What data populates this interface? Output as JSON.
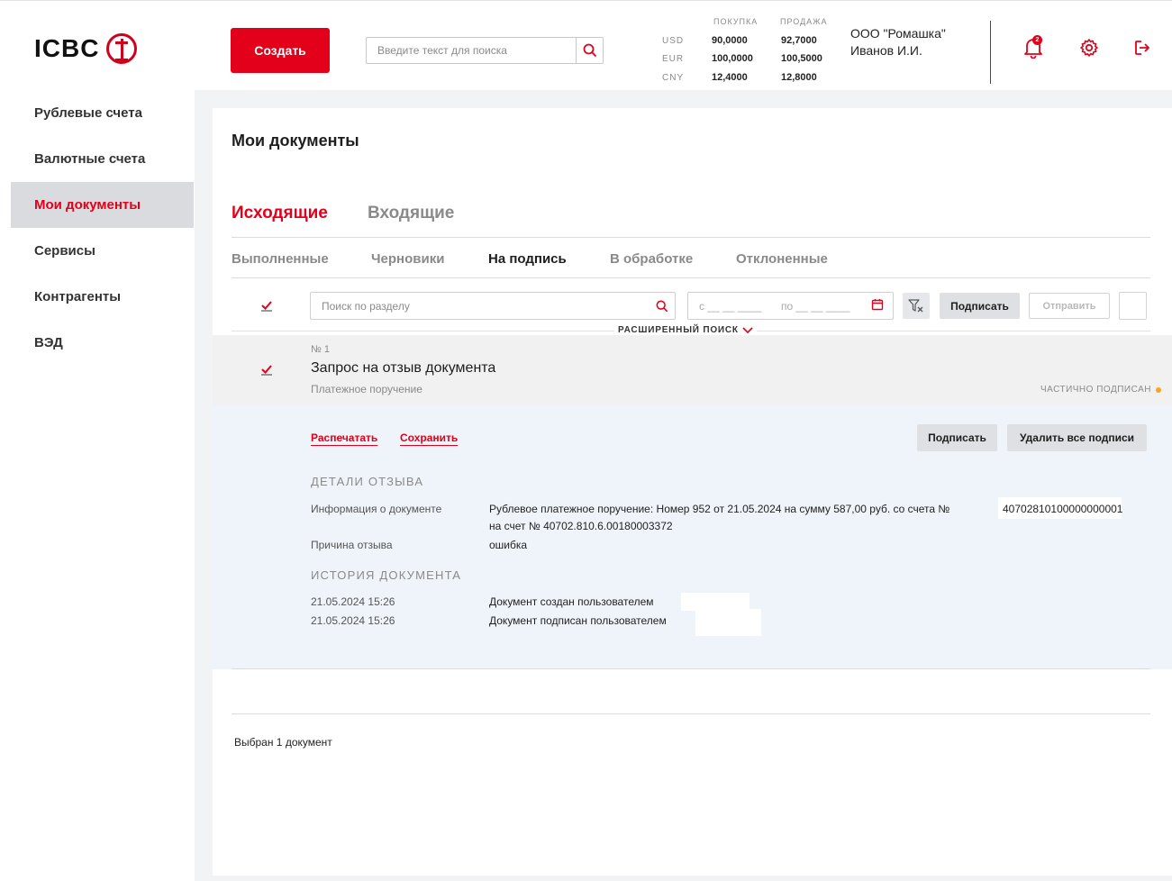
{
  "brand": {
    "logo_text": "ICBC",
    "accent_color": "#e2001a"
  },
  "header": {
    "create_label": "Создать",
    "search_placeholder": "Введите текст для поиска",
    "rates": {
      "buy_header": "ПОКУПКА",
      "sell_header": "ПРОДАЖА",
      "rows": [
        {
          "currency": "USD",
          "buy": "90,0000",
          "sell": "92,7000"
        },
        {
          "currency": "EUR",
          "buy": "100,0000",
          "sell": "100,5000"
        },
        {
          "currency": "CNY",
          "buy": "12,4000",
          "sell": "12,8000"
        }
      ]
    },
    "org_name": "ООО \"Ромашка\"",
    "user_name": "Иванов И.И.",
    "notifications_count": "2"
  },
  "sidebar": {
    "items": [
      {
        "label": "Рублевые счета"
      },
      {
        "label": "Валютные счета"
      },
      {
        "label": "Мои документы",
        "active": true
      },
      {
        "label": "Сервисы"
      },
      {
        "label": "Контрагенты"
      },
      {
        "label": "ВЭД"
      }
    ]
  },
  "main": {
    "title": "Мои документы",
    "tabs": [
      {
        "label": "Исходящие",
        "active": true
      },
      {
        "label": "Входящие"
      }
    ],
    "subtabs": [
      {
        "label": "Выполненные"
      },
      {
        "label": "Черновики"
      },
      {
        "label": "На подпись",
        "active": true
      },
      {
        "label": "В обработке"
      },
      {
        "label": "Отклоненные"
      }
    ],
    "toolbar": {
      "search_placeholder": "Поиск по разделу",
      "date_from": "с __ __ ____",
      "date_to": "по __ __ ____",
      "sign_label": "Подписать",
      "send_label": "Отправить",
      "advanced_search_label": "РАСШИРЕННЫЙ ПОИСК"
    },
    "document": {
      "number": "№ 1",
      "title": "Запрос на отзыв документа",
      "type": "Платежное поручение",
      "status": "ЧАСТИЧНО ПОДПИСАН",
      "print_label": "Распечатать",
      "save_label": "Сохранить",
      "sign_label": "Подписать",
      "delete_signatures_label": "Удалить все подписи",
      "details_heading": "ДЕТАЛИ ОТЗЫВА",
      "info_label": "Информация о документе",
      "info_value_line1": "Рублевое платежное поручение: Номер 952 от 21.05.2024 на сумму 587,00 руб. со счета №",
      "info_account_from": "40702810100000000001",
      "info_value_line2": "на счет № 40702.810.6.00180003372",
      "reason_label": "Причина отзыва",
      "reason_value": "ошибка",
      "history_heading": "ИСТОРИЯ ДОКУМЕНТА",
      "history": [
        {
          "date": "21.05.2024 15:26",
          "text": "Документ создан пользователем"
        },
        {
          "date": "21.05.2024 15:26",
          "text": "Документ подписан пользователем"
        }
      ]
    },
    "selected_count_text": "Выбран 1 документ"
  }
}
